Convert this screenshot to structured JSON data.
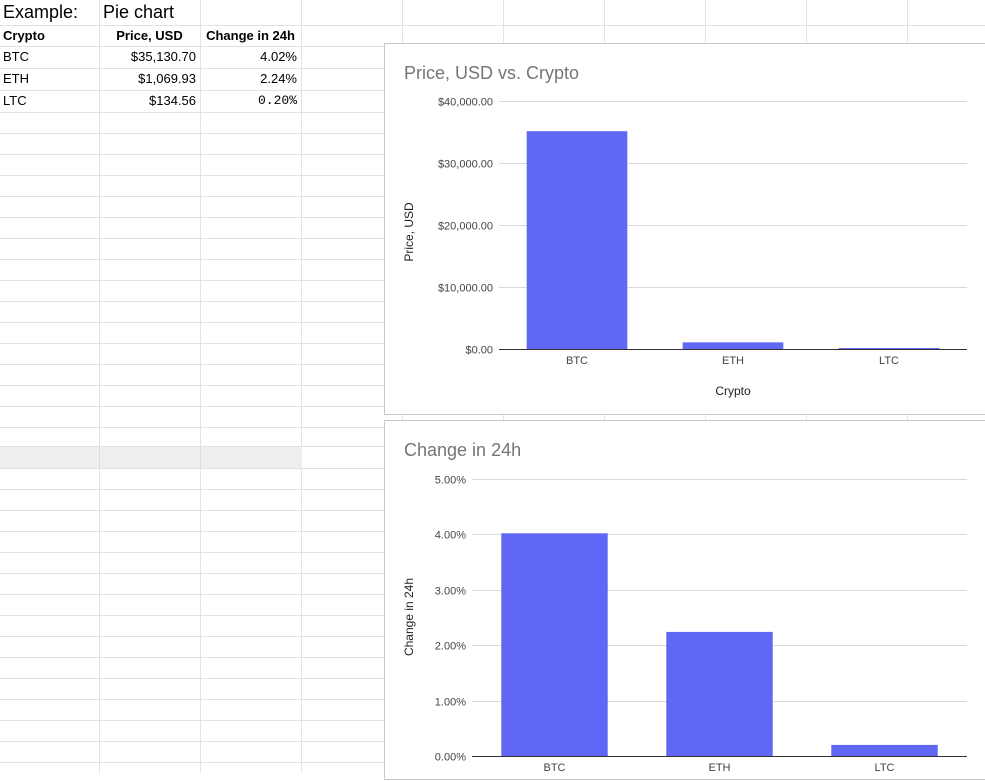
{
  "sheet": {
    "row1": {
      "label": "Example:",
      "value": "Pie chart"
    },
    "headers": [
      "Crypto",
      "Price, USD",
      "Change in 24h"
    ],
    "rows": [
      [
        "BTC",
        "$35,130.70",
        "4.02%"
      ],
      [
        "ETH",
        "$1,069.93",
        "2.24%"
      ],
      [
        "LTC",
        "$134.56",
        "0.20%"
      ]
    ]
  },
  "colors": {
    "bar": "#6067f5",
    "grid": "#d9d9d9",
    "axis": "#333333"
  },
  "chart_data": [
    {
      "type": "bar",
      "title": "Price, USD vs. Crypto",
      "categories": [
        "BTC",
        "ETH",
        "LTC"
      ],
      "values": [
        35130.7,
        1069.93,
        134.56
      ],
      "xlabel": "Crypto",
      "ylabel": "Price, USD",
      "ylim": [
        0,
        40000
      ],
      "yticks": [
        "$0.00",
        "$10,000.00",
        "$20,000.00",
        "$30,000.00",
        "$40,000.00"
      ],
      "ytick_values": [
        0,
        10000,
        20000,
        30000,
        40000
      ],
      "grid": true,
      "legend": "none"
    },
    {
      "type": "bar",
      "title": "Change in 24h",
      "categories": [
        "BTC",
        "ETH",
        "LTC"
      ],
      "values": [
        4.02,
        2.24,
        0.2
      ],
      "xlabel": "",
      "ylabel": "Change in 24h",
      "ylim": [
        0,
        5
      ],
      "yticks": [
        "0.00%",
        "1.00%",
        "2.00%",
        "3.00%",
        "4.00%",
        "5.00%"
      ],
      "ytick_values": [
        0,
        1,
        2,
        3,
        4,
        5
      ],
      "grid": true,
      "legend": "none"
    }
  ]
}
